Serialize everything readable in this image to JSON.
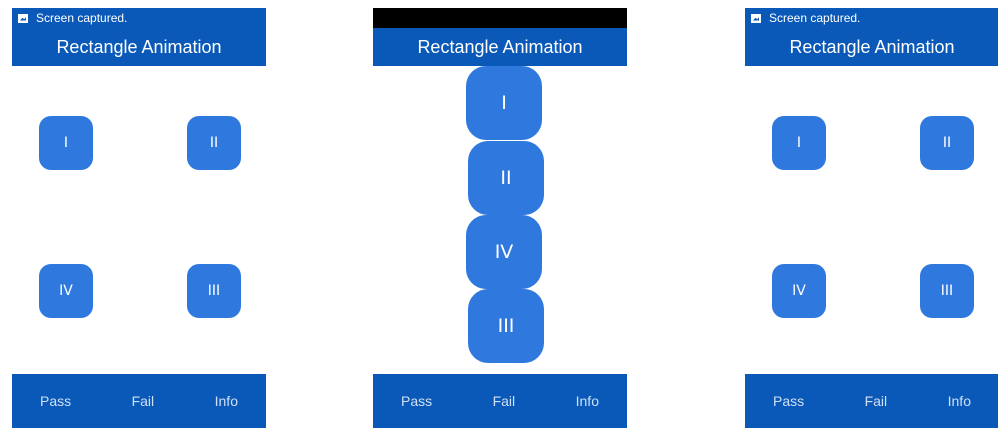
{
  "app_title": "Rectangle Animation",
  "status": {
    "message": "Screen captured."
  },
  "bottom_bar": {
    "pass": "Pass",
    "fail": "Fail",
    "info": "Info"
  },
  "rectangles": {
    "one": "I",
    "two": "II",
    "three": "III",
    "four": "IV"
  },
  "colors": {
    "bar_blue": "#0a59b8",
    "rect_blue": "#2f79de",
    "bottom_text": "#cfe0f6",
    "status_black": "#000000"
  }
}
